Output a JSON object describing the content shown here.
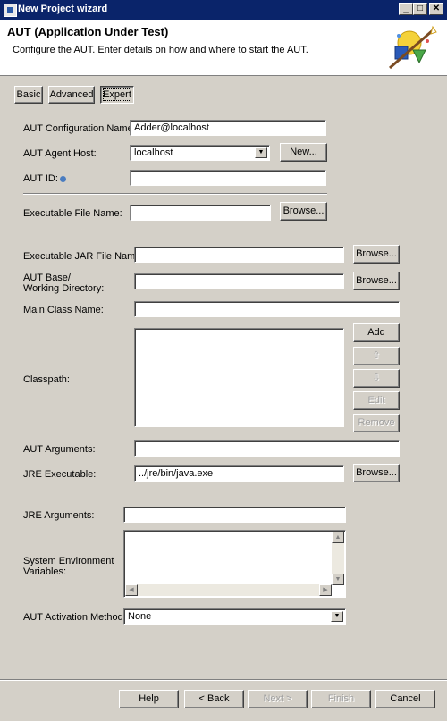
{
  "window": {
    "title": "New Project wizard",
    "buttons": [
      "_",
      "□",
      "✕"
    ]
  },
  "header": {
    "title": "AUT (Application Under Test)",
    "description": "Configure the AUT. Enter details on how and where to start the AUT."
  },
  "modes": {
    "basic": "Basic",
    "advanced": "Advanced",
    "expert": "Expert",
    "selected": "Expert"
  },
  "form": {
    "config_name_label": "AUT Configuration Name:",
    "config_name_value": "Adder@localhost",
    "agent_host_label": "AUT Agent Host:",
    "agent_host_value": "localhost",
    "new_button": "New...",
    "aut_id_label": "AUT ID:",
    "aut_id_value": "",
    "exe_file_label": "Executable File Name:",
    "exe_file_value": "",
    "browse": "Browse...",
    "jar_file_label": "Executable JAR File Name:",
    "jar_file_value": "",
    "base_dir_label1": "AUT Base/",
    "base_dir_label2": "Working Directory:",
    "base_dir_value": "",
    "main_class_label": "Main Class Name:",
    "main_class_value": "",
    "classpath_label": "Classpath:",
    "classpath_add": "Add",
    "classpath_up": "⇧",
    "classpath_down": "⇩",
    "classpath_edit": "Edit",
    "classpath_remove": "Remove",
    "aut_args_label": "AUT Arguments:",
    "aut_args_value": "",
    "jre_exe_label": "JRE Executable:",
    "jre_exe_value": "../jre/bin/java.exe",
    "jre_args_label": "JRE Arguments:",
    "jre_args_value": "",
    "env_label1": "System Environment",
    "env_label2": "Variables:",
    "activation_label": "AUT Activation Method:",
    "activation_value": "None"
  },
  "footer": {
    "help": "Help",
    "back": "< Back",
    "next": "Next >",
    "finish": "Finish",
    "cancel": "Cancel"
  }
}
